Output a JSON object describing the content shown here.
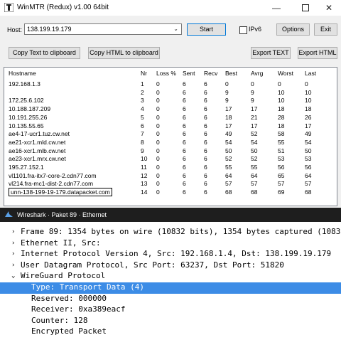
{
  "winmtr": {
    "title": "WinMTR (Redux) v1.00 64bit",
    "host_label": "Host:",
    "host_value": "138.199.19.179",
    "start_label": "Start",
    "ipv6_label": "IPv6",
    "options_label": "Options",
    "exit_label": "Exit",
    "copy_text_label": "Copy Text to clipboard",
    "copy_html_label": "Copy HTML to clipboard",
    "export_text_label": "Export TEXT",
    "export_html_label": "Export HTML",
    "columns": [
      "Hostname",
      "Nr",
      "Loss %",
      "Sent",
      "Recv",
      "Best",
      "Avrg",
      "Worst",
      "Last"
    ],
    "rows": [
      [
        "192.168.1.3",
        "1",
        "0",
        "6",
        "6",
        "0",
        "0",
        "0",
        "0"
      ],
      [
        "",
        "2",
        "0",
        "6",
        "6",
        "9",
        "9",
        "10",
        "10"
      ],
      [
        "172.25.6.102",
        "3",
        "0",
        "6",
        "6",
        "9",
        "9",
        "10",
        "10"
      ],
      [
        "10.188.187.209",
        "4",
        "0",
        "6",
        "6",
        "17",
        "17",
        "18",
        "18"
      ],
      [
        "10.191.255.26",
        "5",
        "0",
        "6",
        "6",
        "18",
        "21",
        "28",
        "26"
      ],
      [
        "10.135.55.65",
        "6",
        "0",
        "6",
        "6",
        "17",
        "17",
        "18",
        "17"
      ],
      [
        "ae4-17-ucr1.tuz.cw.net",
        "7",
        "0",
        "6",
        "6",
        "49",
        "52",
        "58",
        "49"
      ],
      [
        "ae21-xcr1.mld.cw.net",
        "8",
        "0",
        "6",
        "6",
        "54",
        "54",
        "55",
        "54"
      ],
      [
        "ae16-xcr1.mlb.cw.net",
        "9",
        "0",
        "6",
        "6",
        "50",
        "50",
        "51",
        "50"
      ],
      [
        "ae23-xcr1.mrx.cw.net",
        "10",
        "0",
        "6",
        "6",
        "52",
        "52",
        "53",
        "53"
      ],
      [
        "195.27.152.1",
        "11",
        "0",
        "6",
        "6",
        "55",
        "55",
        "56",
        "56"
      ],
      [
        "vl1101.fra-itx7-core-2.cdn77.com",
        "12",
        "0",
        "6",
        "6",
        "64",
        "64",
        "65",
        "64"
      ],
      [
        "vl214.fra-mc1-dist-2.cdn77.com",
        "13",
        "0",
        "6",
        "6",
        "57",
        "57",
        "57",
        "57"
      ],
      [
        "unn-138-199-19-179.datapacket.com",
        "14",
        "0",
        "6",
        "6",
        "68",
        "68",
        "69",
        "68"
      ]
    ]
  },
  "wireshark": {
    "title": "Wireshark · Paket 89 · Ethernet",
    "tree": [
      {
        "arrow": "›",
        "text": "Frame 89: 1354 bytes on wire (10832 bits), 1354 bytes captured (10832 bits)",
        "indent": 0,
        "selected": false
      },
      {
        "arrow": "›",
        "text": "Ethernet II, Src:",
        "indent": 0,
        "selected": false
      },
      {
        "arrow": "›",
        "text": "Internet Protocol Version 4, Src: 192.168.1.4, Dst: 138.199.19.179",
        "indent": 0,
        "selected": false
      },
      {
        "arrow": "›",
        "text": "User Datagram Protocol, Src Port: 63237, Dst Port: 51820",
        "indent": 0,
        "selected": false
      },
      {
        "arrow": "⌄",
        "text": "WireGuard Protocol",
        "indent": 0,
        "selected": false
      },
      {
        "arrow": "",
        "text": "Type: Transport Data (4)",
        "indent": 1,
        "selected": true
      },
      {
        "arrow": "",
        "text": "Reserved: 000000",
        "indent": 1,
        "selected": false
      },
      {
        "arrow": "",
        "text": "Receiver: 0xa389eacf",
        "indent": 1,
        "selected": false
      },
      {
        "arrow": "",
        "text": "Counter: 128",
        "indent": 1,
        "selected": false
      },
      {
        "arrow": "",
        "text": "Encrypted Packet",
        "indent": 1,
        "selected": false
      }
    ]
  }
}
